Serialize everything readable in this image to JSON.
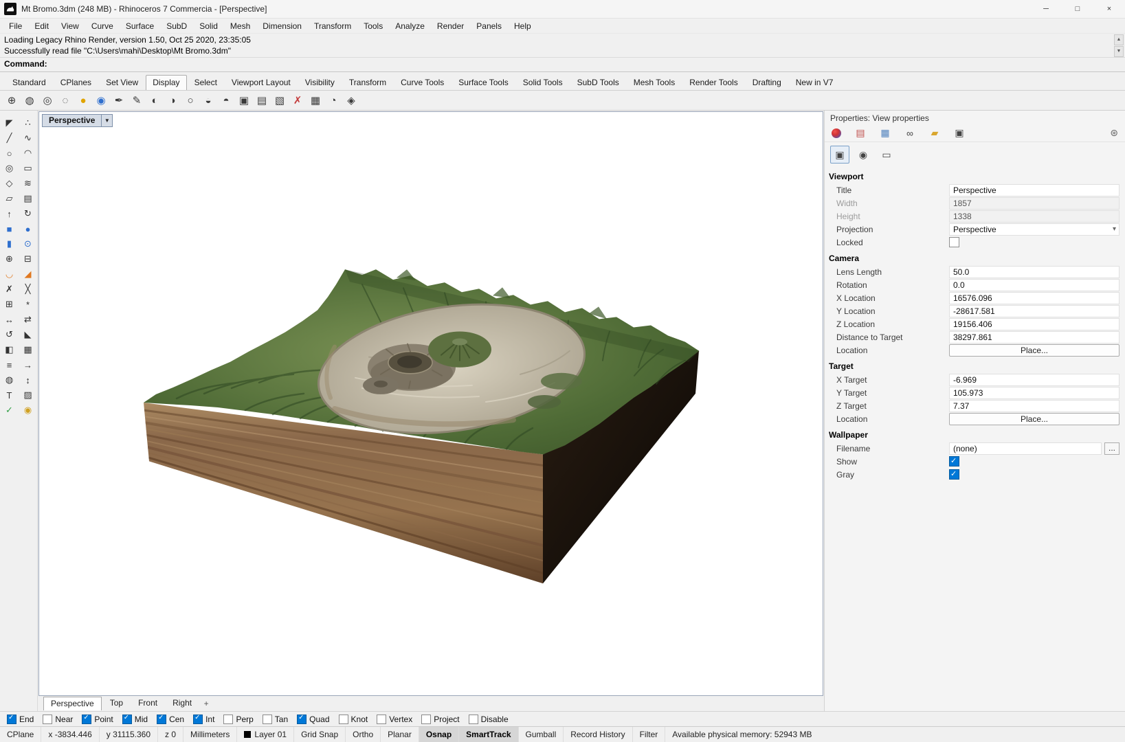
{
  "window": {
    "title": "Mt Bromo.3dm (248 MB) - Rhinoceros 7 Commercia - [Perspective]",
    "controls": {
      "minimize": "─",
      "maximize": "□",
      "close": "×"
    }
  },
  "menubar": {
    "items": [
      {
        "label": "File"
      },
      {
        "label": "Edit"
      },
      {
        "label": "View"
      },
      {
        "label": "Curve"
      },
      {
        "label": "Surface"
      },
      {
        "label": "SubD"
      },
      {
        "label": "Solid"
      },
      {
        "label": "Mesh"
      },
      {
        "label": "Dimension"
      },
      {
        "label": "Transform"
      },
      {
        "label": "Tools"
      },
      {
        "label": "Analyze"
      },
      {
        "label": "Render"
      },
      {
        "label": "Panels"
      },
      {
        "label": "Help"
      }
    ]
  },
  "command_area": {
    "history": [
      "Loading Legacy Rhino Render, version 1.50, Oct 25 2020, 23:35:05",
      "Successfully read file \"C:\\Users\\mahi\\Desktop\\Mt Bromo.3dm\""
    ],
    "prompt_label": "Command:",
    "scroll_up": "▲",
    "scroll_down": "▼"
  },
  "toolbar_tabs": {
    "items": [
      {
        "label": "Standard"
      },
      {
        "label": "CPlanes"
      },
      {
        "label": "Set View"
      },
      {
        "label": "Display",
        "cls": "active"
      },
      {
        "label": "Select"
      },
      {
        "label": "Viewport Layout"
      },
      {
        "label": "Visibility"
      },
      {
        "label": "Transform"
      },
      {
        "label": "Curve Tools"
      },
      {
        "label": "Surface Tools"
      },
      {
        "label": "Solid Tools"
      },
      {
        "label": "SubD Tools"
      },
      {
        "label": "Mesh Tools"
      },
      {
        "label": "Render Tools"
      },
      {
        "label": "Drafting"
      },
      {
        "label": "New in V7"
      }
    ]
  },
  "display_toolbar": {
    "icons": [
      {
        "name": "wireframe-display-icon",
        "glyph": "⊕"
      },
      {
        "name": "shaded-display-icon",
        "glyph": "◍"
      },
      {
        "name": "ghosted-display-icon",
        "glyph": "◎"
      },
      {
        "name": "xray-display-icon",
        "glyph": "◌"
      },
      {
        "name": "rendered-display-icon",
        "glyph": "●",
        "cls": "g-gold"
      },
      {
        "name": "raytraced-display-icon",
        "glyph": "◉",
        "cls": "g-blue"
      },
      {
        "name": "pen-display-icon",
        "glyph": "✒"
      },
      {
        "name": "artistic-display-icon",
        "glyph": "✎"
      },
      {
        "name": "technical-display-icon",
        "glyph": "◐"
      },
      {
        "name": "monochrome-display-icon",
        "glyph": "◑"
      },
      {
        "name": "arctic-display-icon",
        "glyph": "○"
      },
      {
        "name": "shadows-display-icon",
        "glyph": "◒"
      },
      {
        "name": "backfaces-display-icon",
        "glyph": "◓"
      },
      {
        "name": "flat-shade-icon",
        "glyph": "▣"
      },
      {
        "name": "shade-selected-icon",
        "glyph": "▤"
      },
      {
        "name": "display-options-icon",
        "glyph": "▧"
      },
      {
        "name": "clear-drape-icon",
        "glyph": "✗",
        "cls": "g-red"
      },
      {
        "name": "capture-viewport-icon",
        "glyph": "▦"
      },
      {
        "name": "screen-capture-icon",
        "glyph": "◔"
      },
      {
        "name": "package-display-icon",
        "glyph": "◈"
      }
    ]
  },
  "left_toolbar": {
    "tools": [
      {
        "name": "select-tool",
        "glyph": "◤"
      },
      {
        "name": "point-tool",
        "glyph": "∴"
      },
      {
        "name": "polyline-tool",
        "glyph": "╱"
      },
      {
        "name": "curve-tool",
        "glyph": "∿"
      },
      {
        "name": "circle-tool",
        "glyph": "○"
      },
      {
        "name": "arc-tool",
        "glyph": "◠"
      },
      {
        "name": "ellipse-tool",
        "glyph": "◎"
      },
      {
        "name": "rectangle-tool",
        "glyph": "▭"
      },
      {
        "name": "polygon-tool",
        "glyph": "◇"
      },
      {
        "name": "helix-tool",
        "glyph": "≋"
      },
      {
        "name": "surface-tool",
        "glyph": "▱"
      },
      {
        "name": "loft-tool",
        "glyph": "▤"
      },
      {
        "name": "extrude-tool",
        "glyph": "↑"
      },
      {
        "name": "revolve-tool",
        "glyph": "↻"
      },
      {
        "name": "box-tool",
        "glyph": "■",
        "cls": "c-blue"
      },
      {
        "name": "sphere-tool",
        "glyph": "●",
        "cls": "c-blue"
      },
      {
        "name": "cylinder-tool",
        "glyph": "▮",
        "cls": "c-blue"
      },
      {
        "name": "pipe-tool",
        "glyph": "⊙",
        "cls": "c-blue"
      },
      {
        "name": "boolean-union-tool",
        "glyph": "⊕"
      },
      {
        "name": "boolean-difference-tool",
        "glyph": "⊟"
      },
      {
        "name": "fillet-tool",
        "glyph": "◡",
        "cls": "c-orange"
      },
      {
        "name": "chamfer-tool",
        "glyph": "◢",
        "cls": "c-orange"
      },
      {
        "name": "trim-tool",
        "glyph": "✗"
      },
      {
        "name": "split-tool",
        "glyph": "╳"
      },
      {
        "name": "join-tool",
        "glyph": "⊞"
      },
      {
        "name": "explode-tool",
        "glyph": "*"
      },
      {
        "name": "move-tool",
        "glyph": "↔"
      },
      {
        "name": "copy-tool",
        "glyph": "⇄"
      },
      {
        "name": "rotate-tool",
        "glyph": "↺"
      },
      {
        "name": "scale-tool",
        "glyph": "◣"
      },
      {
        "name": "mirror-tool",
        "glyph": "◧"
      },
      {
        "name": "array-tool",
        "glyph": "▦"
      },
      {
        "name": "offset-tool",
        "glyph": "≡"
      },
      {
        "name": "extend-tool",
        "glyph": "→"
      },
      {
        "name": "curve-boolean-tool",
        "glyph": "◍"
      },
      {
        "name": "dimension-tool",
        "glyph": "↕"
      },
      {
        "name": "text-tool",
        "glyph": "T"
      },
      {
        "name": "hatch-tool",
        "glyph": "▨"
      },
      {
        "name": "check-tool",
        "glyph": "✓",
        "cls": "c-green"
      },
      {
        "name": "gumball-tool",
        "glyph": "◉",
        "cls": "c-gold"
      }
    ]
  },
  "viewport": {
    "title": "Perspective",
    "dropdown_glyph": "▼"
  },
  "viewport_tabs": {
    "items": [
      {
        "label": "Perspective",
        "cls": "active"
      },
      {
        "label": "Top"
      },
      {
        "label": "Front"
      },
      {
        "label": "Right"
      }
    ],
    "plus_glyph": "+"
  },
  "properties": {
    "header": "Properties: View properties",
    "gear_glyph": "⊛",
    "tabs": [
      {
        "name": "object-properties-tab",
        "glyph": "●",
        "cls": "t-ball"
      },
      {
        "name": "layers-tab",
        "glyph": "▤",
        "cls": "t-red"
      },
      {
        "name": "display-tab",
        "glyph": "▦",
        "cls": "t-blue"
      },
      {
        "name": "link-tab",
        "glyph": "∞",
        "cls": "t-dark"
      },
      {
        "name": "folder-tab",
        "glyph": "▰",
        "cls": "t-gold"
      },
      {
        "name": "render-tab",
        "glyph": "▣",
        "cls": "t-dark"
      }
    ],
    "subtabs": [
      {
        "name": "camera-settings-tab",
        "glyph": "▣",
        "cls": "active"
      },
      {
        "name": "lens-settings-tab",
        "glyph": "◉"
      },
      {
        "name": "wallpaper-settings-tab",
        "glyph": "▭"
      }
    ],
    "sections": [
      {
        "heading": "Viewport",
        "rows": [
          {
            "label": "Title",
            "value": "Perspective",
            "cls": "input"
          },
          {
            "label": "Width",
            "value": "1857",
            "cls": "input disabled",
            "lcls": "dim"
          },
          {
            "label": "Height",
            "value": "1338",
            "cls": "input disabled",
            "lcls": "dim"
          },
          {
            "label": "Projection",
            "value": "Perspective",
            "cls": "select"
          },
          {
            "label": "Locked",
            "value": "",
            "cls": "checkbox"
          }
        ]
      },
      {
        "heading": "Camera",
        "rows": [
          {
            "label": "Lens Length",
            "value": "50.0",
            "cls": "input"
          },
          {
            "label": "Rotation",
            "value": "0.0",
            "cls": "input"
          },
          {
            "label": "X Location",
            "value": "16576.096",
            "cls": "input"
          },
          {
            "label": "Y Location",
            "value": "-28617.581",
            "cls": "input"
          },
          {
            "label": "Z Location",
            "value": "19156.406",
            "cls": "input"
          },
          {
            "label": "Distance to Target",
            "value": "38297.861",
            "cls": "input"
          },
          {
            "label": "Location",
            "value": "Place...",
            "cls": "button"
          }
        ]
      },
      {
        "heading": "Target",
        "rows": [
          {
            "label": "X Target",
            "value": "-6.969",
            "cls": "input"
          },
          {
            "label": "Y Target",
            "value": "105.973",
            "cls": "input"
          },
          {
            "label": "Z Target",
            "value": "7.37",
            "cls": "input"
          },
          {
            "label": "Location",
            "value": "Place...",
            "cls": "button"
          }
        ]
      },
      {
        "heading": "Wallpaper",
        "rows": [
          {
            "label": "Filename",
            "value": "(none)",
            "cls": "input",
            "extra": "..."
          },
          {
            "label": "Show",
            "value": "",
            "cls": "checkbox checked"
          },
          {
            "label": "Gray",
            "value": "",
            "cls": "checkbox checked"
          }
        ]
      }
    ]
  },
  "osnap": {
    "items": [
      {
        "label": "End",
        "cls": "checked"
      },
      {
        "label": "Near"
      },
      {
        "label": "Point",
        "cls": "checked"
      },
      {
        "label": "Mid",
        "cls": "checked"
      },
      {
        "label": "Cen",
        "cls": "checked"
      },
      {
        "label": "Int",
        "cls": "checked"
      },
      {
        "label": "Perp"
      },
      {
        "label": "Tan"
      },
      {
        "label": "Quad",
        "cls": "checked"
      },
      {
        "label": "Knot"
      },
      {
        "label": "Vertex"
      },
      {
        "label": "Project"
      },
      {
        "label": "Disable"
      }
    ]
  },
  "statusbar": {
    "items": [
      {
        "label": "CPlane"
      },
      {
        "label": "x -3834.446"
      },
      {
        "label": "y 31115.360"
      },
      {
        "label": "z 0"
      },
      {
        "label": "Millimeters"
      },
      {
        "label": "Layer 01",
        "cls": "layer"
      },
      {
        "label": "Grid Snap"
      },
      {
        "label": "Ortho"
      },
      {
        "label": "Planar"
      },
      {
        "label": "Osnap",
        "cls": "active"
      },
      {
        "label": "SmartTrack",
        "cls": "active"
      },
      {
        "label": "Gumball"
      },
      {
        "label": "Record History"
      },
      {
        "label": "Filter"
      },
      {
        "label": "Available physical memory: 52943 MB",
        "cls": "mem"
      }
    ]
  }
}
